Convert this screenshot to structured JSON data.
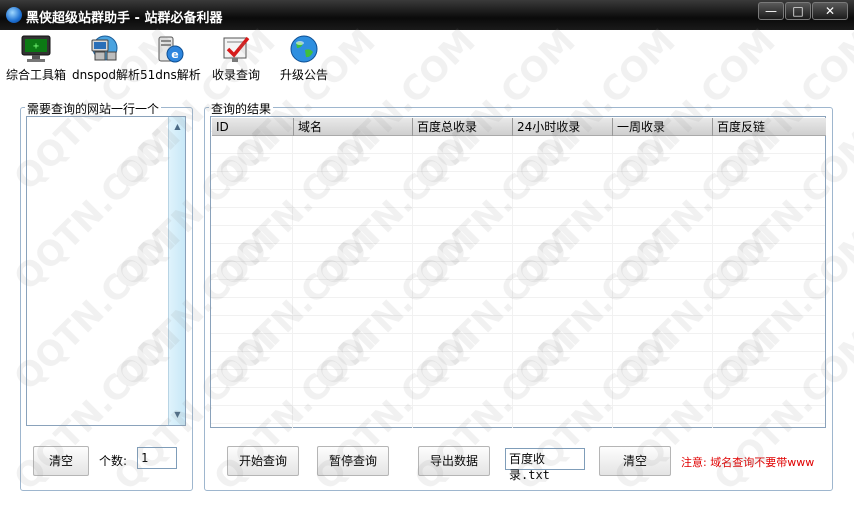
{
  "window": {
    "title": "黑侠超级站群助手 - 站群必备利器",
    "controls": {
      "minimize": "—",
      "maximize": "□",
      "close": "✕"
    }
  },
  "toolbar": {
    "items": [
      {
        "label": "综合工具箱",
        "icon": "monitor-icon"
      },
      {
        "label": "dnspod解析",
        "icon": "network-computer-icon"
      },
      {
        "label": "51dns解析",
        "icon": "ie-server-icon"
      },
      {
        "label": "收录查询",
        "icon": "checkmark-board-icon"
      },
      {
        "label": "升级公告",
        "icon": "globe-icon"
      }
    ]
  },
  "left_panel": {
    "legend": "需要查询的网站一行一个",
    "clear_label": "清空",
    "count_label": "个数:",
    "count_value": "1"
  },
  "right_panel": {
    "legend": "查询的结果",
    "columns": [
      "ID",
      "域名",
      "百度总收录",
      "24小时收录",
      "一周收录",
      "百度反链"
    ],
    "buttons": {
      "start": "开始查询",
      "pause": "暂停查询",
      "export": "导出数据",
      "clear": "清空"
    },
    "filename_value": "百度收录.txt",
    "notice": "注意: 域名查询不要带www"
  },
  "watermark": {
    "text": "QQTN.COM",
    "color": "#969696"
  }
}
